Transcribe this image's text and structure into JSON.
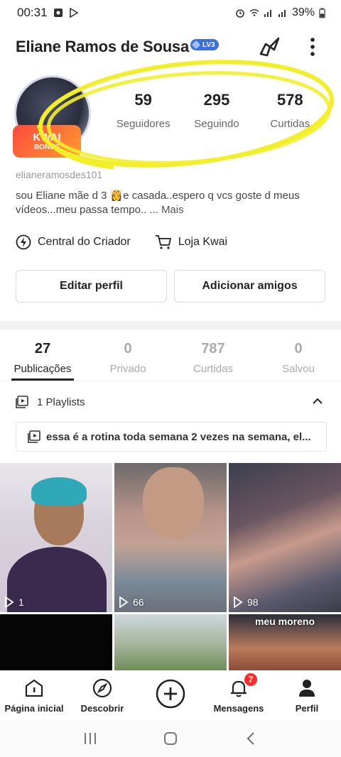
{
  "status_bar": {
    "time": "00:31",
    "battery": "39%"
  },
  "profile": {
    "name": "Eliane Ramos de Sousa",
    "level": "LV3",
    "badge_title": "KWAI",
    "badge_subtitle": "BONUS",
    "handle": "elianeramosdes101",
    "bio": "sou Eliane mãe d 3 👸e casada..espero q vcs goste d meus vídeos...meu passa tempo.. ...",
    "bio_more": "Mais"
  },
  "stats": [
    {
      "value": "59",
      "label": "Seguidores"
    },
    {
      "value": "295",
      "label": "Seguindo"
    },
    {
      "value": "578",
      "label": "Curtidas"
    }
  ],
  "links": {
    "creator_center": "Central do Criador",
    "shop": "Loja Kwai"
  },
  "buttons": {
    "edit_profile": "Editar perfil",
    "add_friends": "Adicionar amigos"
  },
  "tabs": [
    {
      "count": "27",
      "label": "Publicações",
      "active": true
    },
    {
      "count": "0",
      "label": "Privado",
      "active": false
    },
    {
      "count": "787",
      "label": "Curtidas",
      "active": false
    },
    {
      "count": "0",
      "label": "Salvou",
      "active": false
    }
  ],
  "playlists": {
    "header": "1 Playlists",
    "item": "essa é a rotina toda semana 2 vezes na semana, el..."
  },
  "videos": [
    {
      "views": "1"
    },
    {
      "views": "66"
    },
    {
      "views": "98"
    },
    {
      "views": ""
    },
    {
      "views": ""
    },
    {
      "views": "",
      "caption": "meu moreno"
    }
  ],
  "bottom_nav": {
    "home": "Página inicial",
    "discover": "Descobrir",
    "messages": "Mensagens",
    "messages_badge": "7",
    "profile": "Perfil"
  },
  "colors": {
    "highlight": "#f3ee2a",
    "badge_red": "#ff2a2a",
    "level_blue": "#3b6fe0"
  }
}
